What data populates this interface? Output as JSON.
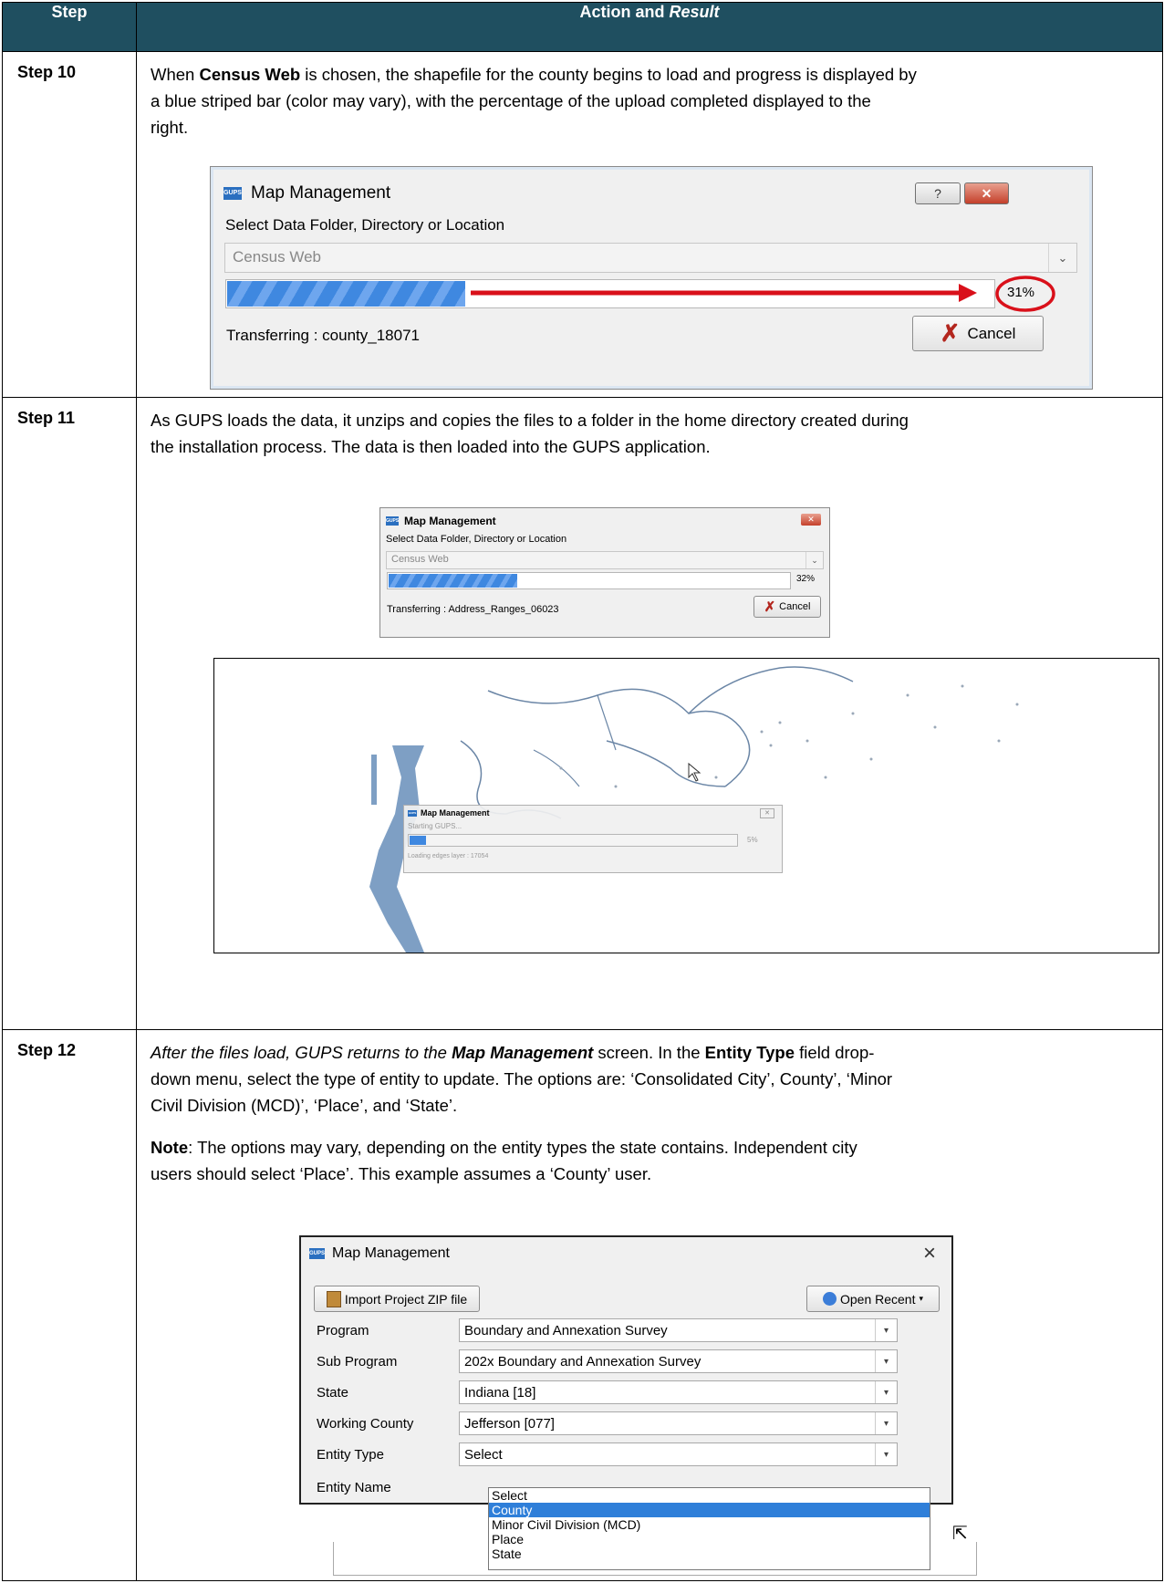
{
  "table": {
    "col_step": "Step",
    "col_action_plain": "Action and ",
    "col_action_italic": "Result"
  },
  "step10": {
    "label": "Step 10",
    "text_a": "When ",
    "text_b": "Census Web",
    "text_c": " is chosen, the shapefile for the county begins to load and progress is displayed by",
    "text_line2": "a blue striped bar (color may vary), with the percentage of the upload completed displayed to the",
    "text_line3": "right.",
    "dialog": {
      "title": "Map Management",
      "help_btn": "?",
      "close_btn": "✕",
      "select_label": "Select Data Folder, Directory or Location",
      "location_value": "Census Web",
      "progress_pct": 31,
      "progress_text": "31%",
      "status": "Transferring : county_18071",
      "cancel_btn": "Cancel"
    }
  },
  "step11": {
    "label": "Step 11",
    "text_line1": "As GUPS loads the data, it unzips and copies the files to a folder in the home directory created during",
    "text_line2": "the installation process. The data is then loaded into the GUPS application.",
    "dialog": {
      "title": "Map Management",
      "select_label": "Select Data Folder, Directory or Location",
      "location_value": "Census Web",
      "progress_pct": 32,
      "progress_text": "32%",
      "status": "Transferring : Address_Ranges_06023",
      "cancel_btn": "Cancel"
    },
    "map_dialog": {
      "title": "Map Management",
      "status_top": "Starting GUPS...",
      "progress_pct": 5,
      "progress_text": "5%",
      "status_bottom": "Loading edges layer : 17054"
    }
  },
  "step12": {
    "label": "Step 12",
    "p1_italic_a": "After the files load, GUPS returns to the ",
    "p1_bold_italic": "Map Management",
    "p1_b": " screen. In the ",
    "p1_bold": "Entity Type",
    "p1_c": " field drop-",
    "p1_line2": "down menu, select the type of entity to update. The options are: ‘Consolidated City’, County’, ‘Minor",
    "p1_line3": "Civil Division (MCD)’, ‘Place’, and ‘State’.",
    "note_bold": "Note",
    "note_a": ":  The options may vary, depending on the entity types the state contains. Independent city",
    "note_line2": "users should select ‘Place’. This example assumes a ‘County’ user.",
    "dialog": {
      "title": "Map Management",
      "close_btn": "×",
      "import_btn": "Import Project ZIP file",
      "open_recent_btn": "Open Recent",
      "program_label": "Program",
      "program_value": "Boundary and Annexation Survey",
      "subprogram_label": "Sub Program",
      "subprogram_value": "202x Boundary and Annexation Survey",
      "state_label": "State",
      "state_value": "Indiana [18]",
      "county_label": "Working County",
      "county_value": "Jefferson [077]",
      "entity_type_label": "Entity Type",
      "entity_type_value": "Select",
      "entity_name_label": "Entity Name",
      "options": [
        "Select",
        "County",
        "Minor Civil Division (MCD)",
        "Place",
        "State"
      ],
      "highlighted_option": "County"
    }
  },
  "colors": {
    "header_bg": "#1f4f60",
    "accent_red": "#d9101a",
    "progress_blue": "#3f88e0"
  }
}
